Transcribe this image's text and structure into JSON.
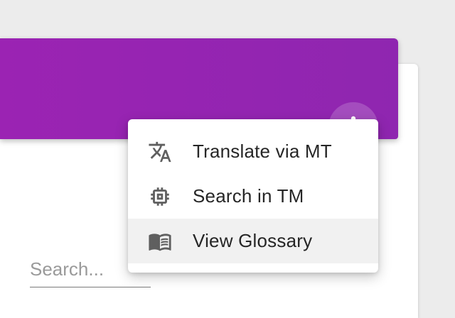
{
  "header": {
    "accent_color": "#9b23b3",
    "more_button_icon": "more-vert-icon"
  },
  "search": {
    "placeholder": "Search...",
    "value": ""
  },
  "menu": {
    "items": [
      {
        "label": "Translate via MT",
        "icon": "translate-icon"
      },
      {
        "label": "Search in TM",
        "icon": "memory-chip-icon"
      },
      {
        "label": "View Glossary",
        "icon": "book-open-icon",
        "highlighted": true
      }
    ]
  }
}
